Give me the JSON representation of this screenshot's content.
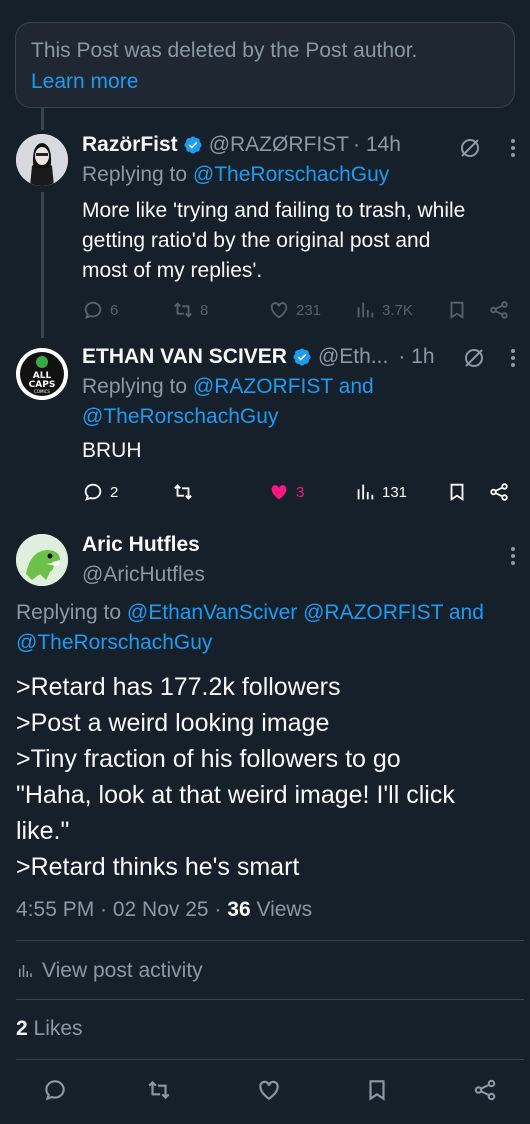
{
  "deleted_notice": {
    "text": "This Post was deleted by the Post author.",
    "link": "Learn more"
  },
  "colors": {
    "background": "#15202b",
    "accent": "#1d9bf0",
    "like": "#f91880",
    "muted": "#8b98a5"
  },
  "posts": [
    {
      "name": "RazörFist",
      "handle": "@RAZØRFIST",
      "time": "· 14h",
      "replying_prefix": "Replying to ",
      "replying_to": "@TheRorschachGuy",
      "text_lines": [
        "More like 'trying and failing to trash, while",
        "getting ratio'd by the original post and",
        "most of my replies'."
      ],
      "replies": "6",
      "reposts": "8",
      "likes": "231",
      "views": "3.7K"
    },
    {
      "name": "ETHAN VAN SCIVER",
      "handle": "@Eth...",
      "time": "· 1h",
      "replying_prefix": "Replying to ",
      "replying_to_1": "@RAZORFIST",
      "and_word": " and",
      "replying_to_2": "@TheRorschachGuy",
      "text": "BRUH",
      "replies": "2",
      "likes": "3",
      "views": "131",
      "avatar_text": [
        "ALL",
        "CAPS",
        "COMICS"
      ]
    }
  ],
  "main_post": {
    "name": "Aric Hutfles",
    "handle": "@AricHutfles",
    "replying_prefix": "Replying to ",
    "replying_to_1": "@EthanVanSciver",
    "replying_to_2": "@RAZORFIST",
    "and_word": " and",
    "replying_to_3": "@TheRorschachGuy",
    "text_lines": [
      ">Retard has 177.2k followers",
      ">Post a weird looking image",
      ">Tiny fraction of his followers to go",
      "\"Haha, look at that weird image! I'll click",
      "like.\"",
      ">Retard thinks he's smart"
    ],
    "timestamp": "4:55 PM · 02 Nov 25 · ",
    "views_count": "36",
    "views_label": " Views",
    "activity_label": "View post activity",
    "likes_count": "2",
    "likes_label": " Likes"
  }
}
